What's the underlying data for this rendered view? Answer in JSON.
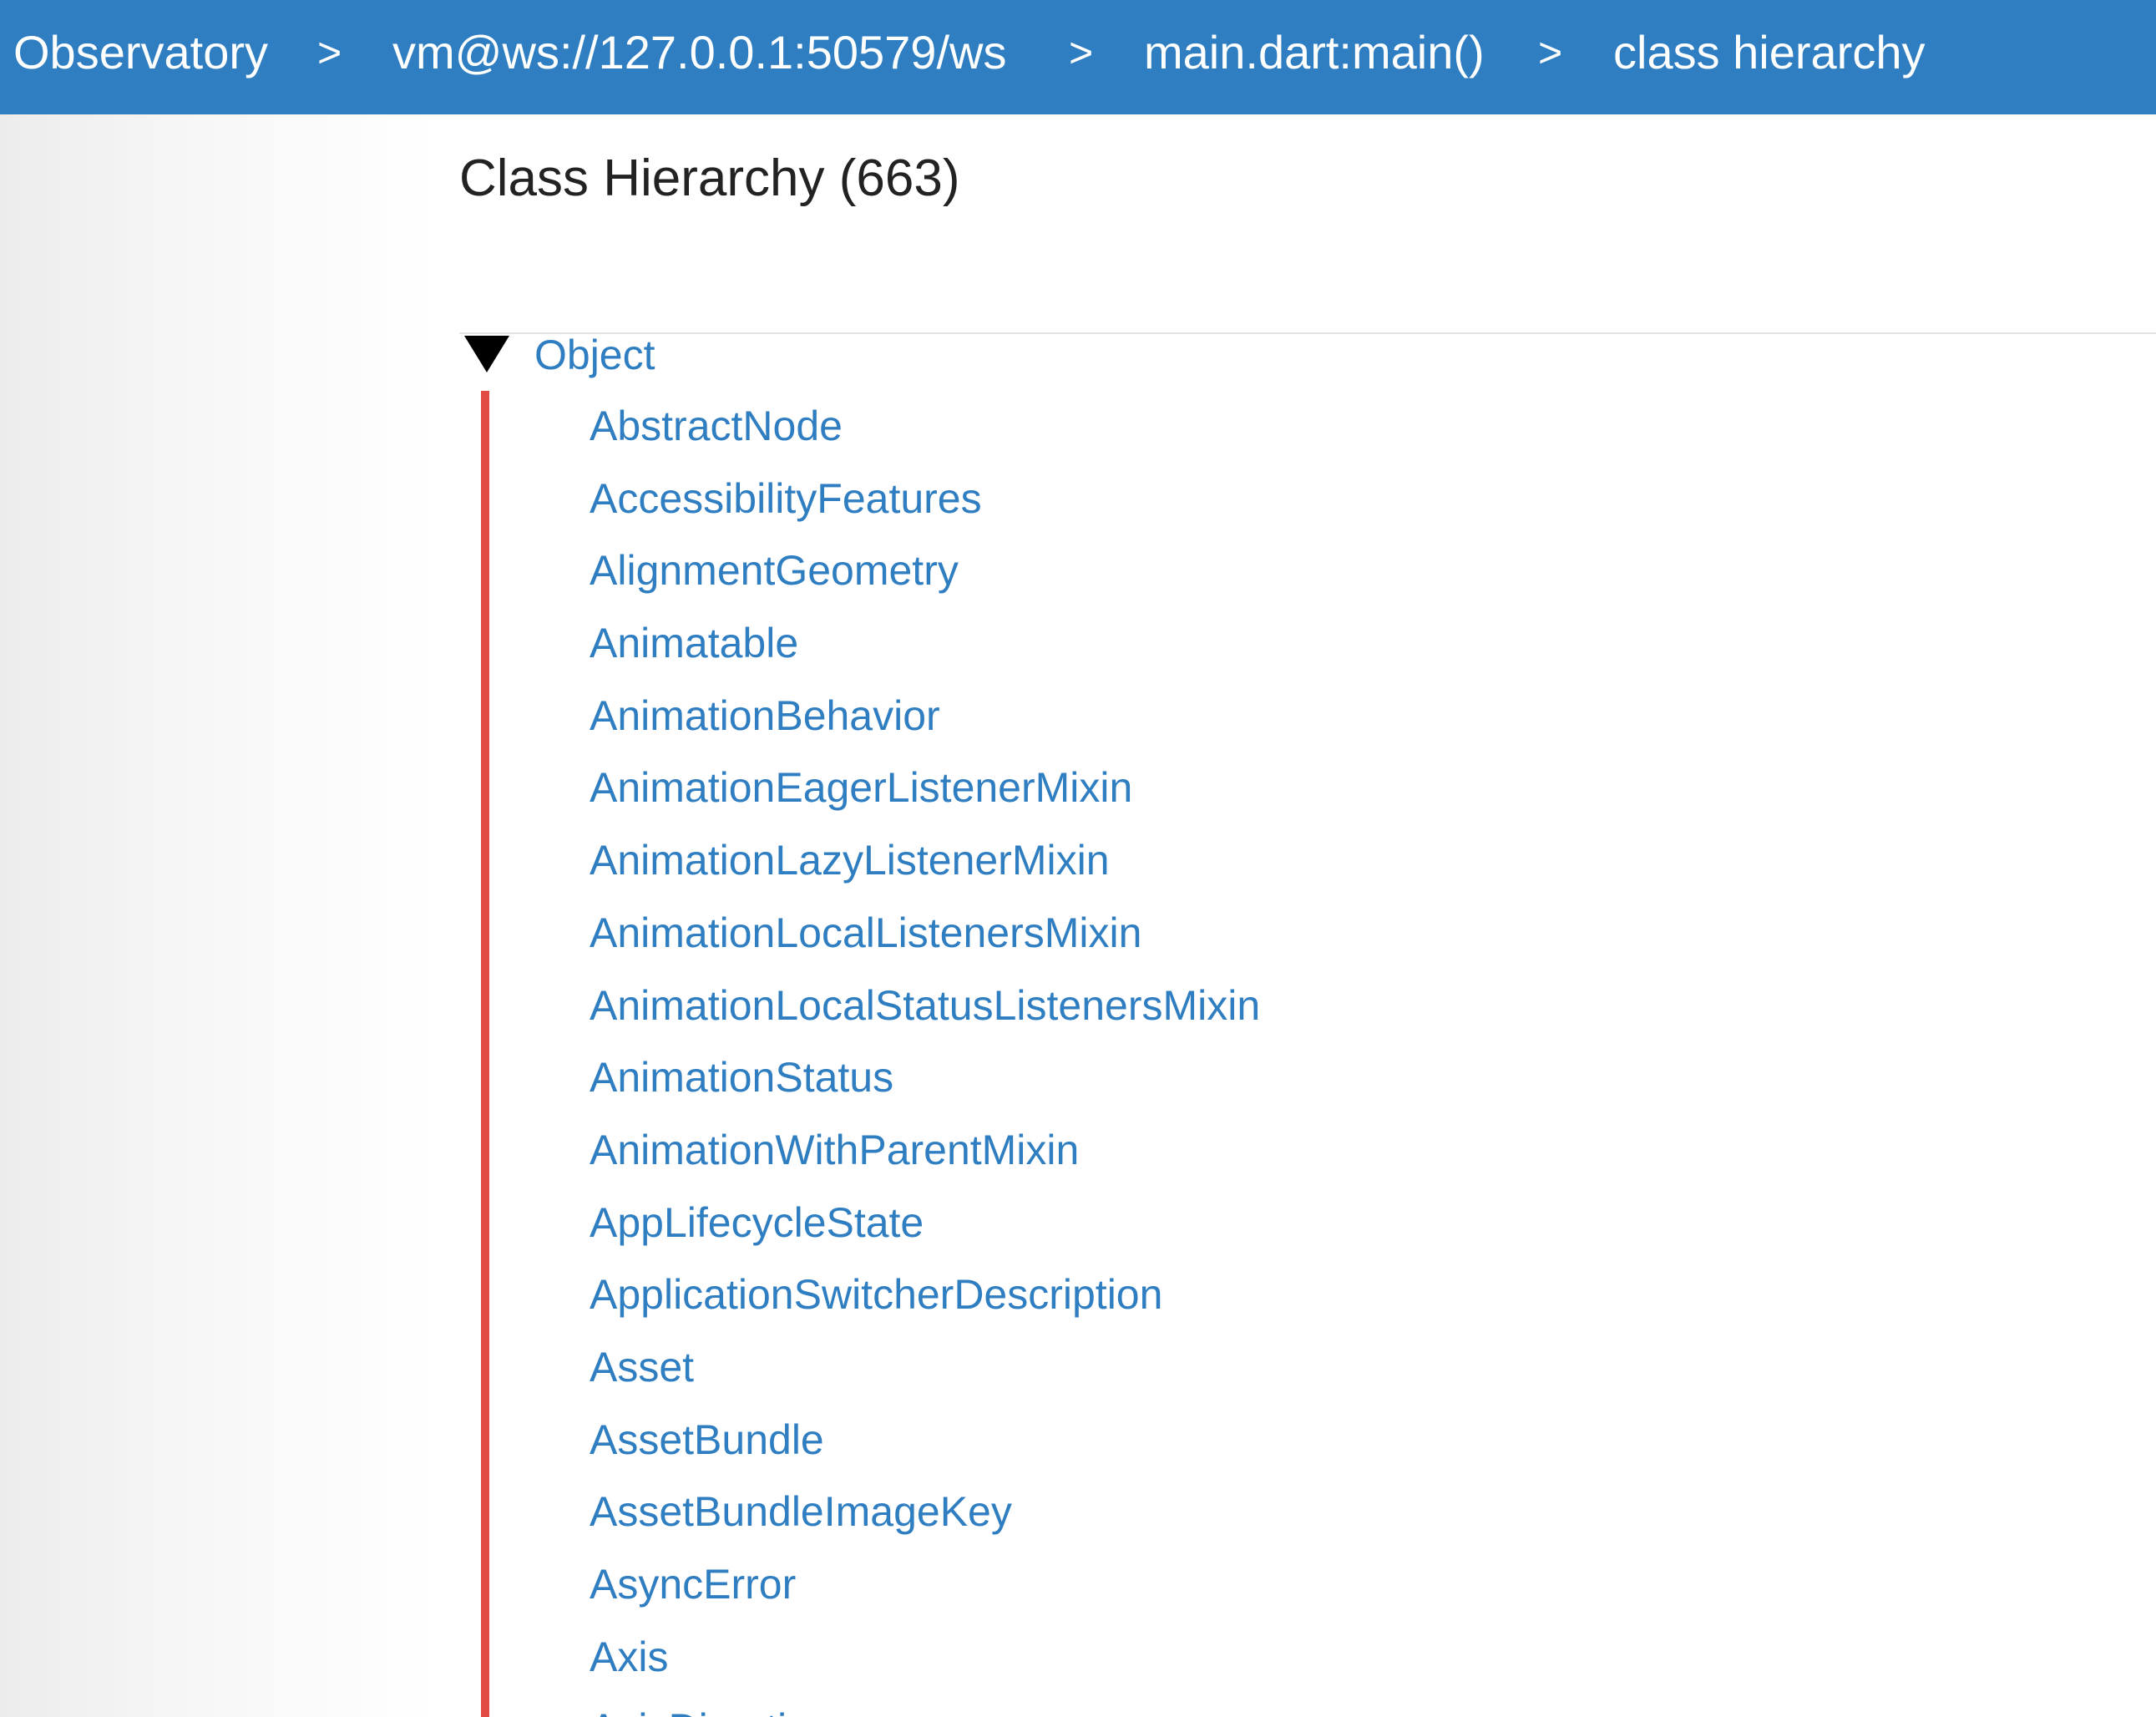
{
  "breadcrumb": {
    "items": [
      {
        "label": "Observatory"
      },
      {
        "label": "vm@ws://127.0.0.1:50579/ws"
      },
      {
        "label": "main.dart:main()"
      },
      {
        "label": "class hierarchy"
      }
    ],
    "separator": ">"
  },
  "main": {
    "title": "Class Hierarchy (663)",
    "tree": {
      "root": {
        "label": "Object",
        "expanded": true,
        "toggle_icon": "triangle-down"
      },
      "children": [
        "AbstractNode",
        "AccessibilityFeatures",
        "AlignmentGeometry",
        "Animatable",
        "AnimationBehavior",
        "AnimationEagerListenerMixin",
        "AnimationLazyListenerMixin",
        "AnimationLocalListenersMixin",
        "AnimationLocalStatusListenersMixin",
        "AnimationStatus",
        "AnimationWithParentMixin",
        "AppLifecycleState",
        "ApplicationSwitcherDescription",
        "Asset",
        "AssetBundle",
        "AssetBundleImageKey",
        "AsyncError",
        "Axis",
        "AxisDirection"
      ]
    }
  },
  "colors": {
    "navbar": "#2f7ec1",
    "link": "#2f7ec1",
    "tree_line": "#e14b43"
  }
}
